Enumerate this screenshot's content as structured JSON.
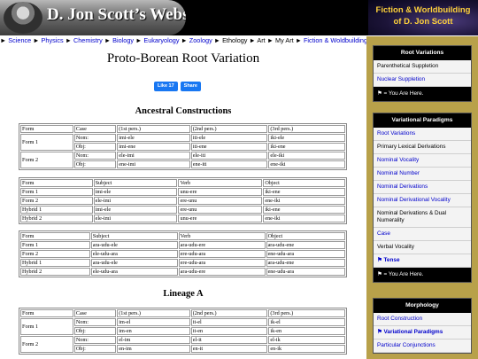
{
  "header": {
    "site_name": "D. Jon Scott’s Website",
    "banner_line1": "Fiction & Worldbuilding",
    "banner_line2": "of D. Jon Scott"
  },
  "breadcrumb": [
    {
      "label": "Science",
      "link": true
    },
    {
      "label": "Physics",
      "link": true
    },
    {
      "label": "Chemistry",
      "link": true
    },
    {
      "label": "Biology",
      "link": true
    },
    {
      "label": "Eukaryology",
      "link": true
    },
    {
      "label": "Zoology",
      "link": true
    },
    {
      "label": "Ethology",
      "link": false
    },
    {
      "label": "Art",
      "link": false
    },
    {
      "label": "My Art",
      "link": false
    },
    {
      "label": "Fiction & Woldbuilding",
      "link": true
    },
    {
      "label": "Fantasy",
      "link": false
    }
  ],
  "breadcrumb_arrow": "►",
  "page": {
    "title": "Proto-Borean Root Variation",
    "like_label": "Like 17",
    "share_label": "Share",
    "section1": "Ancestral Constructions",
    "section2": "Lineage A"
  },
  "tables": {
    "t1": {
      "header": [
        "Form",
        "Case",
        "(1st pers.)",
        "(2nd pers.)",
        "(3rd pers.)"
      ],
      "rows": [
        [
          "Form 1",
          "Nom:",
          "imi-ele",
          "iti-ele",
          "iki-ele"
        ],
        [
          "",
          "Obj:",
          "imi-ene",
          "iti-ene",
          "iki-ene"
        ],
        [
          "Form 2",
          "Nom:",
          "ele-imi",
          "ele-iti",
          "ele-iki"
        ],
        [
          "",
          "Obj:",
          "ene-imi",
          "ene-iti",
          "ene-iki"
        ]
      ]
    },
    "t2": {
      "header": [
        "Form",
        "Subject",
        "Verb",
        "Object"
      ],
      "rows": [
        [
          "Form 1",
          "imi-ele",
          "unu-ere",
          "iki-ene"
        ],
        [
          "Form 2",
          "ele-imi",
          "ere-unu",
          "ene-iki"
        ],
        [
          "Hybrid 1",
          "imi-ele",
          "ere-unu",
          "iki-ene"
        ],
        [
          "Hybrid 2",
          "ele-imi",
          "unu-ere",
          "ene-iki"
        ]
      ]
    },
    "t3": {
      "header": [
        "Form",
        "Subject",
        "Verb",
        "Object"
      ],
      "rows": [
        [
          "Form 1",
          "ara-udu-ele",
          "ara-udu-ere",
          "ara-udu-ene"
        ],
        [
          "Form 2",
          "ele-udu-ara",
          "ere-udu-ara",
          "ene-udu-ara"
        ],
        [
          "Hybrid 1",
          "ara-udu-ele",
          "ere-udu-ara",
          "ara-udu-ene"
        ],
        [
          "Hybrid 2",
          "ele-udu-ara",
          "ara-udu-ere",
          "ene-udu-ara"
        ]
      ]
    },
    "t4": {
      "header": [
        "Form",
        "Case",
        "(1st pers.)",
        "(2nd pers.)",
        "(3rd pers.)"
      ],
      "rows": [
        [
          "Form 1",
          "Nom:",
          "im-el",
          "it-el",
          "ik-el"
        ],
        [
          "",
          "Obj:",
          "im-en",
          "it-en",
          "ik-en"
        ],
        [
          "Form 2",
          "Nom:",
          "el-im",
          "el-it",
          "el-ik"
        ],
        [
          "",
          "Obj:",
          "en-im",
          "en-it",
          "en-ik"
        ]
      ]
    }
  },
  "sidebar": {
    "box1": {
      "title": "Root Variations",
      "items": [
        {
          "label": "Parenthetical Suppletion",
          "kind": "plain"
        },
        {
          "label": "Nuclear Suppletion",
          "kind": "lnk"
        }
      ],
      "here": "⚑ = You Are Here."
    },
    "box2": {
      "title": "Variational Paradigms",
      "items": [
        {
          "label": "Root Variations",
          "kind": "lnk"
        },
        {
          "label": "Primary Lexical Derivations",
          "kind": "plain"
        },
        {
          "label": "Nominal Vocality",
          "kind": "lnk"
        },
        {
          "label": "Nominal Number",
          "kind": "lnk"
        },
        {
          "label": "Nominal Derivations",
          "kind": "lnk"
        },
        {
          "label": "Nominal Derivational Vocality",
          "kind": "lnk"
        },
        {
          "label": "Nominal Derivations & Dual Numerality",
          "kind": "plain"
        },
        {
          "label": "Case",
          "kind": "lnk"
        },
        {
          "label": "Verbal Vocality",
          "kind": "plain"
        },
        {
          "label": "⚑ Tense",
          "kind": "curlnk"
        }
      ],
      "here": "⚑ = You Are Here."
    },
    "box3": {
      "title": "Morphology",
      "items": [
        {
          "label": "Root Construction",
          "kind": "lnk"
        },
        {
          "label": "⚑ Variational Paradigms",
          "kind": "curlnk"
        },
        {
          "label": "Particular Conjunctions",
          "kind": "lnk"
        }
      ]
    }
  }
}
